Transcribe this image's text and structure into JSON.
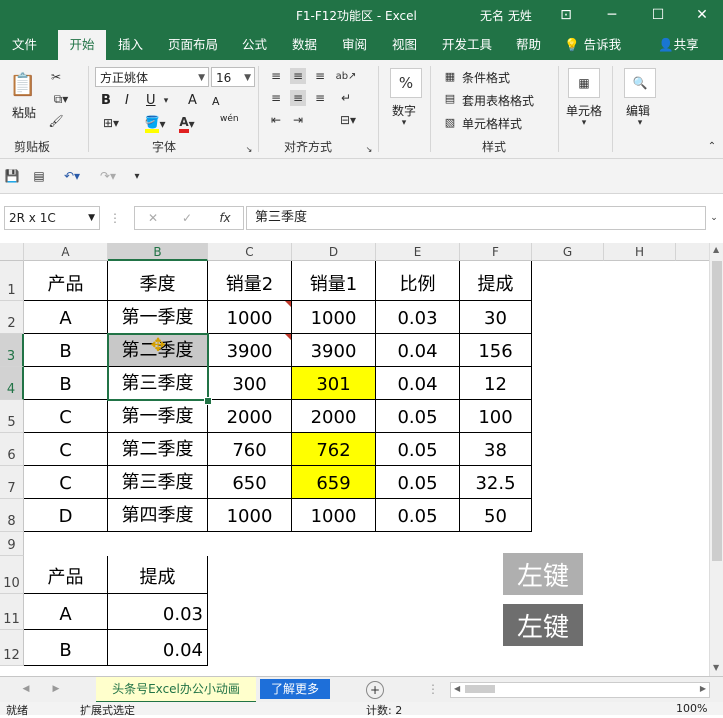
{
  "window": {
    "title": "F1-F12功能区  -  Excel",
    "user": "无名 无姓",
    "buttons": {
      "minimize": "─",
      "restore": "☐",
      "close": "✕",
      "ribbon_opts": "⊡"
    }
  },
  "ribbon_tabs": [
    "文件",
    "开始",
    "插入",
    "页面布局",
    "公式",
    "数据",
    "审阅",
    "视图",
    "开发工具",
    "帮助"
  ],
  "tell_me": "告诉我",
  "share": "共享",
  "ribbon": {
    "clipboard": {
      "paste": "粘贴",
      "label": "剪贴板"
    },
    "font": {
      "name": "方正姚体",
      "size": "16",
      "bold": "B",
      "italic": "I",
      "underline": "U",
      "grow": "A",
      "shrink": "A",
      "label": "字体",
      "wen": "wén"
    },
    "alignment": {
      "label": "对齐方式"
    },
    "number": {
      "label": "数字",
      "pct": "%"
    },
    "styles": {
      "cond": "条件格式",
      "table": "套用表格格式",
      "cell": "单元格样式",
      "label": "样式"
    },
    "cells": {
      "label": "单元格"
    },
    "editing": {
      "label": "编辑"
    }
  },
  "namebox": "2R x 1C",
  "formula": "第三季度",
  "fx": "fx",
  "columns": [
    "A",
    "B",
    "C",
    "D",
    "E",
    "F",
    "G",
    "H"
  ],
  "rows": [
    "1",
    "2",
    "3",
    "4",
    "5",
    "6",
    "7",
    "8",
    "9",
    "10",
    "11",
    "12"
  ],
  "table1": {
    "headers": [
      "产品",
      "季度",
      "销量2",
      "销量1",
      "比例",
      "提成"
    ],
    "data": [
      [
        "A",
        "第一季度",
        "1000",
        "1000",
        "0.03",
        "30"
      ],
      [
        "B",
        "第二季度",
        "3900",
        "3900",
        "0.04",
        "156"
      ],
      [
        "B",
        "第三季度",
        "300",
        "301",
        "0.04",
        "12"
      ],
      [
        "C",
        "第一季度",
        "2000",
        "2000",
        "0.05",
        "100"
      ],
      [
        "C",
        "第二季度",
        "760",
        "762",
        "0.05",
        "38"
      ],
      [
        "C",
        "第三季度",
        "650",
        "659",
        "0.05",
        "32.5"
      ],
      [
        "D",
        "第四季度",
        "1000",
        "1000",
        "0.05",
        "50"
      ]
    ]
  },
  "table2": {
    "headers": [
      "产品",
      "提成"
    ],
    "data": [
      [
        "A",
        "0.03"
      ],
      [
        "B",
        "0.04"
      ]
    ]
  },
  "key_overlays": [
    "左键",
    "左键"
  ],
  "sheet_tabs": [
    "头条号Excel办公小动画",
    "了解更多"
  ],
  "status": {
    "mode": "就绪",
    "ext": "扩展式选定",
    "count": "计数: 2",
    "zoom": "100%"
  },
  "colors": {
    "excel_green": "#217346",
    "highlight": "#ffff00",
    "sheet_tab_bg": "#ffffcc",
    "more_tab_bg": "#1e6fd9"
  }
}
